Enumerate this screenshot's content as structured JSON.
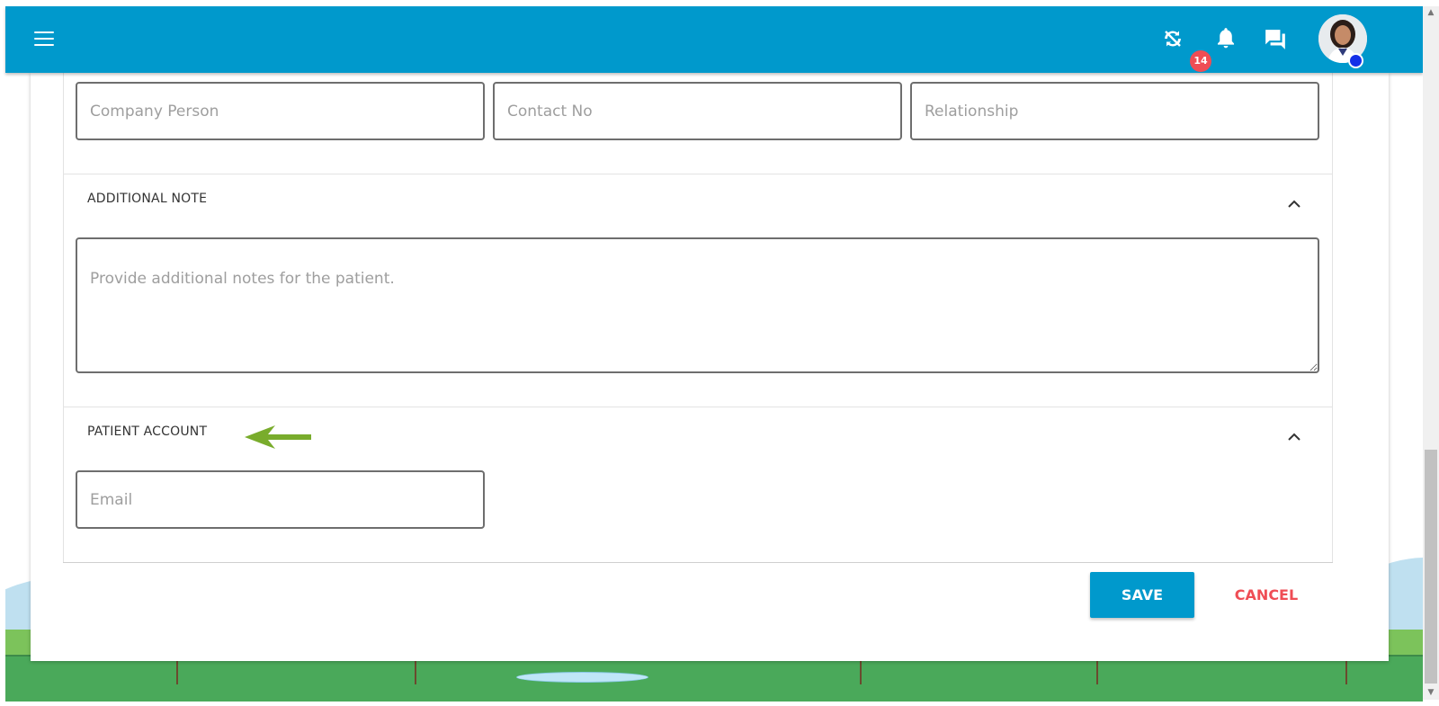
{
  "header": {
    "menu_icon": "hamburger-menu-icon",
    "icons": [
      "sync-disabled-icon",
      "notification-bell-icon",
      "chat-icon"
    ],
    "notification_count": "14",
    "status_color": "#1430e8",
    "accent": "#0099cc"
  },
  "contact": {
    "company_person_placeholder": "Company Person",
    "contact_no_placeholder": "Contact No",
    "relationship_placeholder": "Relationship"
  },
  "additional_note": {
    "title": "ADDITIONAL NOTE",
    "placeholder": "Provide additional notes for the patient."
  },
  "patient_account": {
    "title": "PATIENT ACCOUNT",
    "email_placeholder": "Email"
  },
  "actions": {
    "save_label": "SAVE",
    "cancel_label": "CANCEL",
    "cancel_color": "#ef4d55"
  }
}
